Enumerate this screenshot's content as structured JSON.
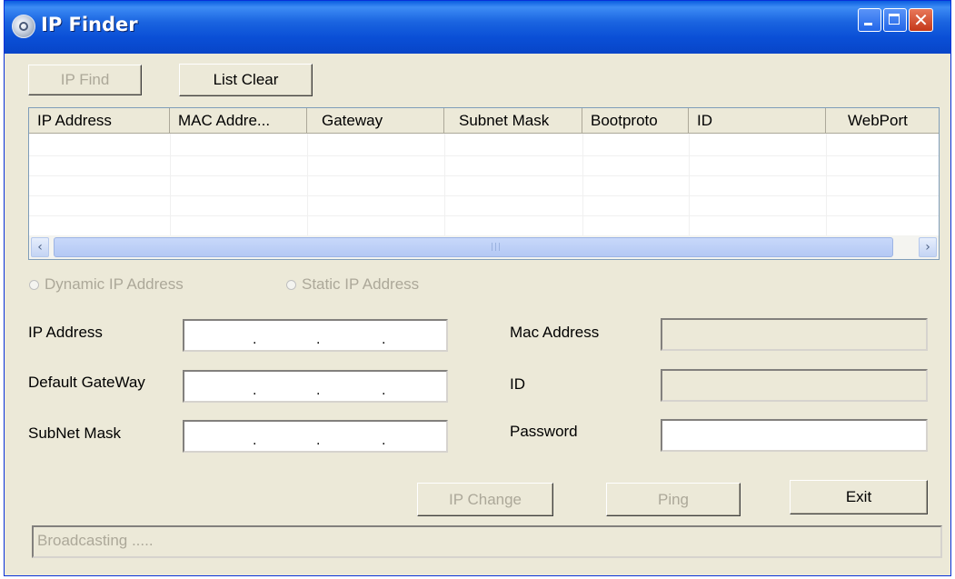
{
  "window": {
    "title": "IP Finder",
    "close_glyph": "✕",
    "icons": {
      "app": "app-globe-icon",
      "minimize": "minimize-icon",
      "maximize": "maximize-icon",
      "close": "close-icon"
    }
  },
  "toolbar": {
    "ip_find_label": "IP Find",
    "list_clear_label": "List Clear"
  },
  "list": {
    "columns": [
      "IP Address",
      "MAC Addre...",
      "Gateway",
      "Subnet Mask",
      "Bootproto",
      "ID",
      "WebPort"
    ],
    "rows": [],
    "scroll_left_glyph": "‹",
    "scroll_right_glyph": "›",
    "scroll_grip": "|||"
  },
  "mode": {
    "dynamic_label": "Dynamic IP Address",
    "static_label": "Static IP Address",
    "dynamic_selected": false,
    "static_selected": false,
    "enabled": false
  },
  "form": {
    "ip_address_label": "IP Address",
    "gateway_label": "Default GateWay",
    "subnet_label": "SubNet Mask",
    "mac_label": "Mac Address",
    "id_label": "ID",
    "password_label": "Password",
    "ip_address_value": "",
    "gateway_value": "",
    "subnet_value": "",
    "mac_value": "",
    "id_value": "",
    "password_value": "",
    "ip_dot": "."
  },
  "actions": {
    "ip_change_label": "IP Change",
    "ping_label": "Ping",
    "exit_label": "Exit"
  },
  "status": {
    "text": "Broadcasting ....."
  },
  "colors": {
    "titlebar": "#0a4fd6",
    "window_bg": "#ece9d8",
    "disabled_text": "#aca899"
  }
}
